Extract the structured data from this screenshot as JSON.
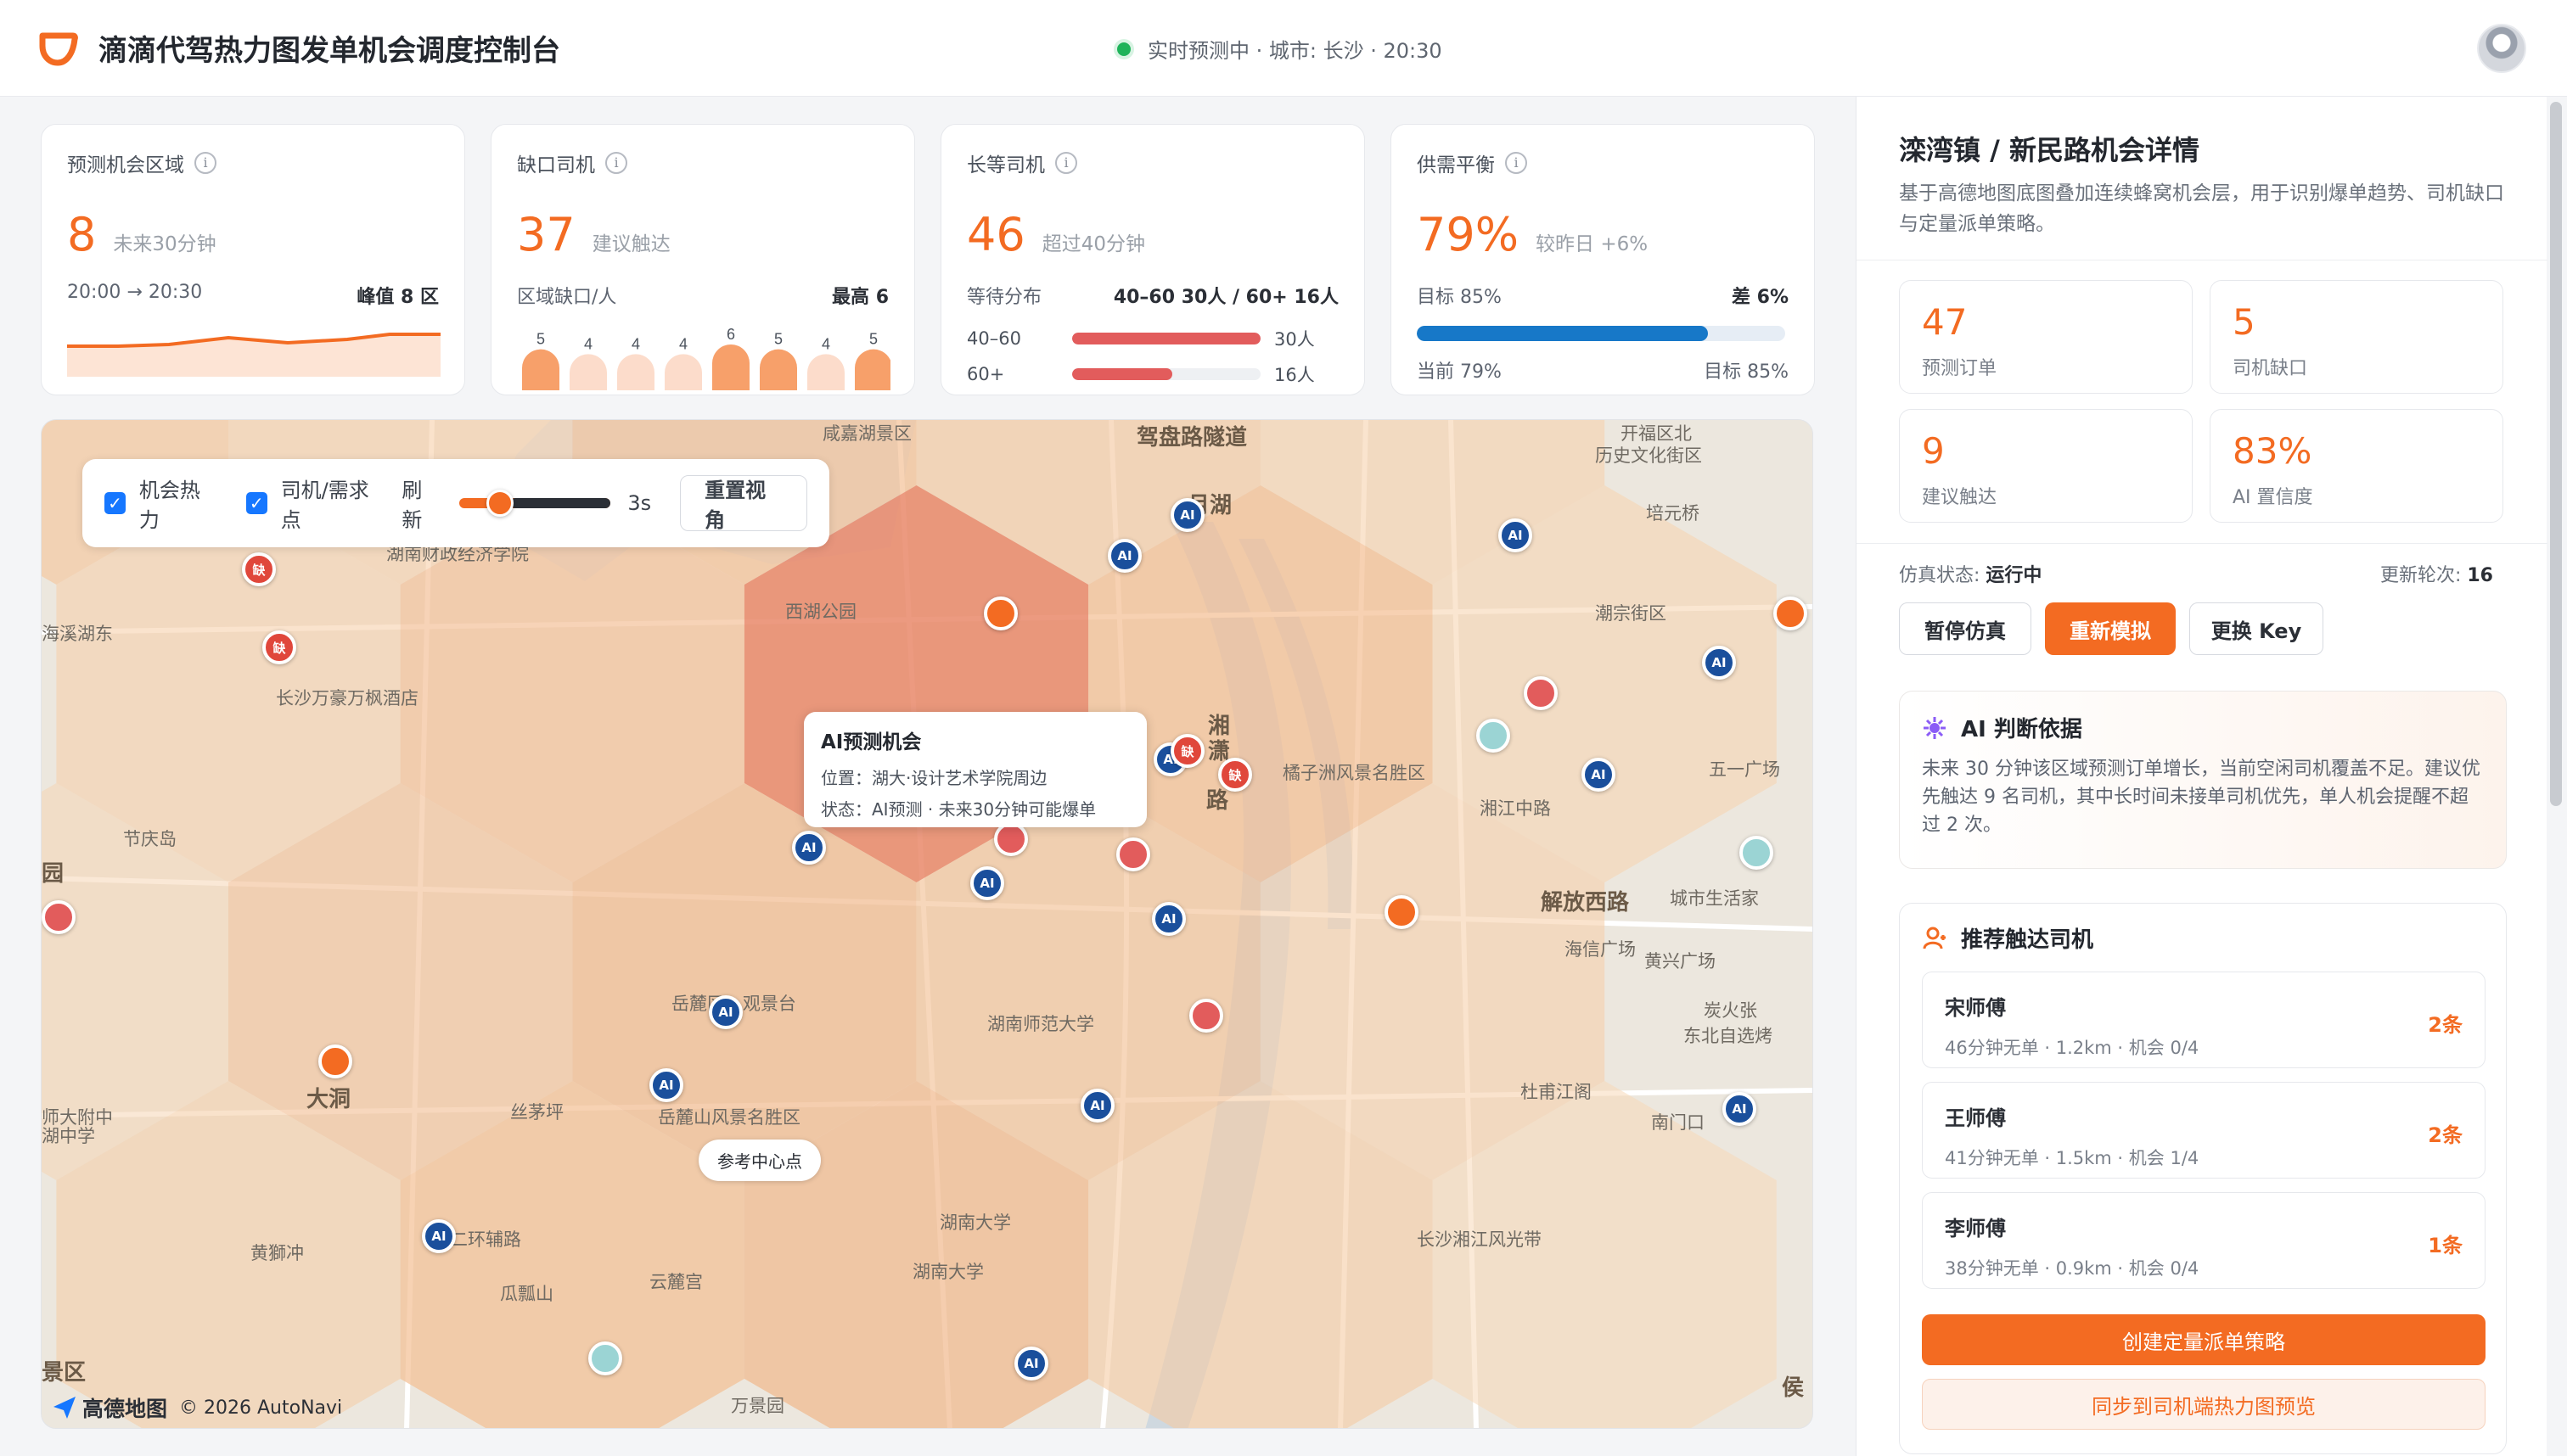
{
  "header": {
    "title": "滴滴代驾热力图发单机会调度控制台",
    "status": "实时预测中 · 城市: 长沙 · 20:30"
  },
  "kpis": [
    {
      "label": "预测机会区域",
      "value": "8",
      "unit": "未来30分钟",
      "left": "20:00 → 20:30",
      "right": "峰值 8 区"
    },
    {
      "label": "缺口司机",
      "value": "37",
      "unit": "建议触达",
      "left": "区域缺口/人",
      "right": "最高 6",
      "bars": [
        5,
        4,
        4,
        4,
        6,
        5,
        4,
        5
      ],
      "bar_labels": [
        "5",
        "4",
        "4",
        "4",
        "6",
        "5",
        "4",
        "5"
      ]
    },
    {
      "label": "长等司机",
      "value": "46",
      "unit": "超过40分钟",
      "left": "等待分布",
      "right": "40–60 30人 / 60+ 16人",
      "dist": [
        {
          "label": "40–60",
          "value": "30人",
          "count": 30
        },
        {
          "label": "60+",
          "value": "16人",
          "count": 16
        }
      ]
    },
    {
      "label": "供需平衡",
      "value": "79%",
      "unit": "较昨日 +6%",
      "left": "目标 85%",
      "right": "差 6%",
      "progress": 0.79,
      "foot_left": "当前 79%",
      "foot_right": "目标 85%"
    }
  ],
  "map": {
    "controls": {
      "heat_label": "机会热力",
      "driver_label": "司机/需求点",
      "refresh_label": "刷新",
      "refresh_value": "3s",
      "refresh_level": 0.15,
      "reset_label": "重置视角"
    },
    "tooltip": {
      "title": "AI预测机会",
      "location": "位置：湖大·设计艺术学院周边",
      "status": "状态：AI预测 · 未来30分钟可能爆单"
    },
    "center_pill": "参考中心点",
    "attribution_brand": "高德地图",
    "attribution": "© 2026 AutoNavi",
    "labels": [
      "咸嘉湖景区",
      "驾盘路隧道",
      "西湖公园",
      "月湖",
      "开福区北",
      "历史文化街区",
      "培元桥",
      "潮宗街区",
      "湖南财政经济学院",
      "海溪湖东",
      "长沙万豪万枫酒店",
      "橘子洲风景名胜区",
      "湘江中路",
      "五一广场",
      "解放西路",
      "城市生活家",
      "节庆岛",
      "海信广场",
      "黄兴广场",
      "炭火张",
      "东北自选烤",
      "岳麓区 - 观景台",
      "湖南师范大学",
      "大洞",
      "丝茅坪",
      "岳麓山风景名胜区",
      "杜甫江阁",
      "南门口",
      "师大附中",
      "湖中学",
      "黄獅冲",
      "西二环辅路",
      "湖南大学",
      "湖南大学",
      "云麓宫",
      "瓜瓢山",
      "长沙湘江风光带",
      "万景园",
      "景区",
      "侯",
      "湘",
      "路",
      "潇",
      "园"
    ],
    "marker_ai": "AI",
    "marker_short": "缺"
  },
  "panel": {
    "title": "滦湾镇 / 新民路机会详情",
    "desc": "基于高德地图底图叠加连续蜂窝机会层，用于识别爆单趋势、司机缺口与定量派单策略。",
    "stats": [
      {
        "value": "47",
        "label": "预测订单"
      },
      {
        "value": "5",
        "label": "司机缺口"
      },
      {
        "value": "9",
        "label": "建议触达"
      },
      {
        "value": "83%",
        "label": "AI 置信度"
      }
    ],
    "sim_state_label": "仿真状态:",
    "sim_state_value": "运行中",
    "round_label": "更新轮次:",
    "round_value": "16",
    "btn_pause": "暂停仿真",
    "btn_rerun": "重新模拟",
    "btn_key": "更换 Key",
    "ai_title": "AI 判断依据",
    "ai_text": "未来 30 分钟该区域预测订单增长，当前空闲司机覆盖不足。建议优先触达 9 名司机，其中长时间未接单司机优先，单人机会提醒不超过 2 次。",
    "drivers_title": "推荐触达司机",
    "drivers": [
      {
        "name": "宋师傅",
        "meta": "46分钟无单 · 1.2km · 机会 0/4",
        "count": "2条"
      },
      {
        "name": "王师傅",
        "meta": "41分钟无单 · 1.5km · 机会 1/4",
        "count": "2条"
      },
      {
        "name": "李师傅",
        "meta": "38分钟无单 · 0.9km · 机会 0/4",
        "count": "1条"
      }
    ],
    "create_btn": "创建定量派单策略",
    "sync_btn": "同步到司机端热力图预览"
  },
  "colors": {
    "accent": "#f36b22",
    "progress": "#1778c8",
    "danger": "#e25c5c",
    "live": "#1fb35a"
  }
}
